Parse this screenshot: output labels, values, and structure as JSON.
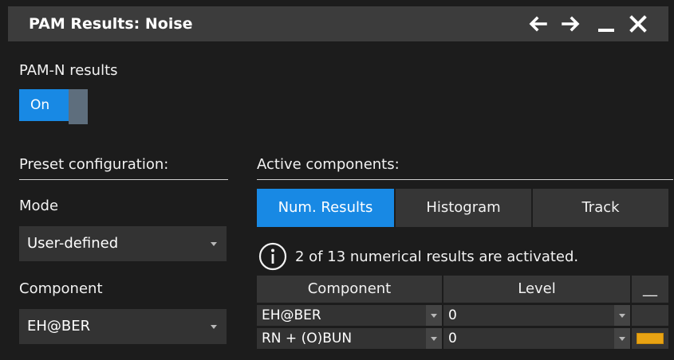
{
  "window": {
    "title": "PAM Results: Noise",
    "buttons": [
      "back-arrow-icon",
      "forward-arrow-icon",
      "minimize-icon",
      "close-icon"
    ]
  },
  "pamn": {
    "label": "PAM-N results",
    "toggle_state": "On"
  },
  "preset": {
    "heading": "Preset configuration:",
    "mode_label": "Mode",
    "mode_value": "User-defined",
    "component_label": "Component",
    "component_value": "EH@BER"
  },
  "active": {
    "heading": "Active components:",
    "tabs": [
      {
        "label": "Num. Results",
        "active": true
      },
      {
        "label": "Histogram",
        "active": false
      },
      {
        "label": "Track",
        "active": false
      }
    ],
    "info_text": "2  of 13 numerical results are activated.",
    "table": {
      "headers": [
        "Component",
        "Level",
        "__"
      ],
      "rows": [
        {
          "component": "EH@BER",
          "level": "0",
          "color": ""
        },
        {
          "component": "RN + (O)BUN",
          "level": "0",
          "color": "#e8a313"
        }
      ]
    }
  },
  "colors": {
    "accent": "#1889e4",
    "titlebar": "#3c3c3c",
    "swatch": "#e8a313"
  }
}
